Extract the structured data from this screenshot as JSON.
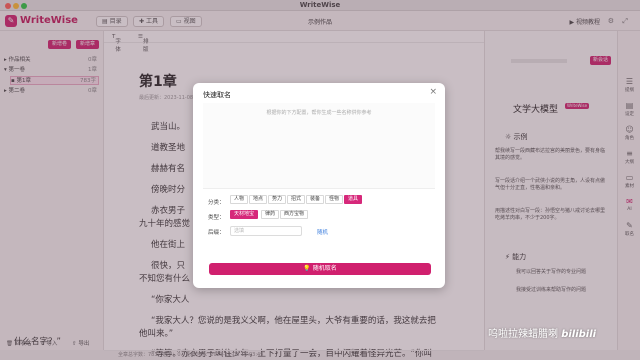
{
  "window": {
    "title": "WriteWise"
  },
  "header": {
    "brand": "WriteWise",
    "catalog_label": "目录",
    "tools_label": "工具",
    "view_label": "视图",
    "doc_title": "示例作品",
    "tutorial_label": "视频教程"
  },
  "sidebar": {
    "add_volume_label": "新增卷",
    "add_chapter_label": "新增章",
    "tree": [
      {
        "label": "作品相关",
        "count": "0章"
      },
      {
        "label": "第一卷",
        "count": "1章"
      },
      {
        "label": "第1章",
        "count": "783字"
      },
      {
        "label": "第二卷",
        "count": "0章"
      }
    ],
    "bottom": {
      "recycle_label": "回收站",
      "import_label": "导入",
      "export_label": "导出"
    }
  },
  "editor": {
    "toolbar": {
      "font_label": "字体",
      "layout_label": "排版"
    },
    "chapter_title": "第1章",
    "meta": "最后更新：2023-11-08",
    "paragraphs": [
      "武当山。",
      "道教圣地",
      "赫赫有名",
      "傍晚时分",
      "赤衣男子",
      "九十年的感觉",
      "他在街上",
      "很快，只",
      "不知您有什么",
      "“你家大人",
      "“我家大人？您说的是我义父啊，他在屋里头，大爷有重要的话，我这就去把",
      "他叫来。”",
      "“等等。”赤衣男子叫住少年，上下打量了一会，目中闪耀着怪异光芒。“你叫",
      "什么名字？”"
    ],
    "status": {
      "word_count": "全章总字数：783",
      "selected": "选中：0",
      "updated": "更新时间：2023-11-08 16:03:49"
    }
  },
  "right_panel": {
    "new_button": "新会话",
    "ai_title": "文学大模型",
    "ai_badge": "WriteWise",
    "example_heading": "示例",
    "examples": [
      "帮我续写一段西藏布达拉宫的美丽景色，要有身临其境的感觉。",
      "写一段话介绍一个武侠小说的男主角，人设有点傲气但十分正直，性格温和亲和。",
      "用描述性对白写一段：孙悟空与猪八戒讨论去哪里吃烤羊肉串，不少于200字。"
    ],
    "ability_heading": "能力",
    "abilities": [
      "我可以回答关于写作的专业问题",
      "我接受过训练来帮助写作的问题"
    ]
  },
  "rail": {
    "items": [
      "提纲",
      "设定",
      "角色",
      "大纲",
      "素材",
      "AI",
      "取名"
    ]
  },
  "modal": {
    "title": "快速取名",
    "hint": "根据你的下方配置，帮你生成一些名称供你参考",
    "category_label": "分类：",
    "categories": [
      "人物",
      "地点",
      "势力",
      "招式",
      "装备",
      "怪物",
      "道具"
    ],
    "type_label": "类型：",
    "types": [
      "天材地宝",
      "律药",
      "西方宝物"
    ],
    "suffix_label": "后缀：",
    "suffix_placeholder": "选填",
    "random_link": "随机",
    "generate_button": "随机取名"
  },
  "watermark": {
    "text": "呜啦拉辣蜡腊喇",
    "logo": "bilibili"
  }
}
